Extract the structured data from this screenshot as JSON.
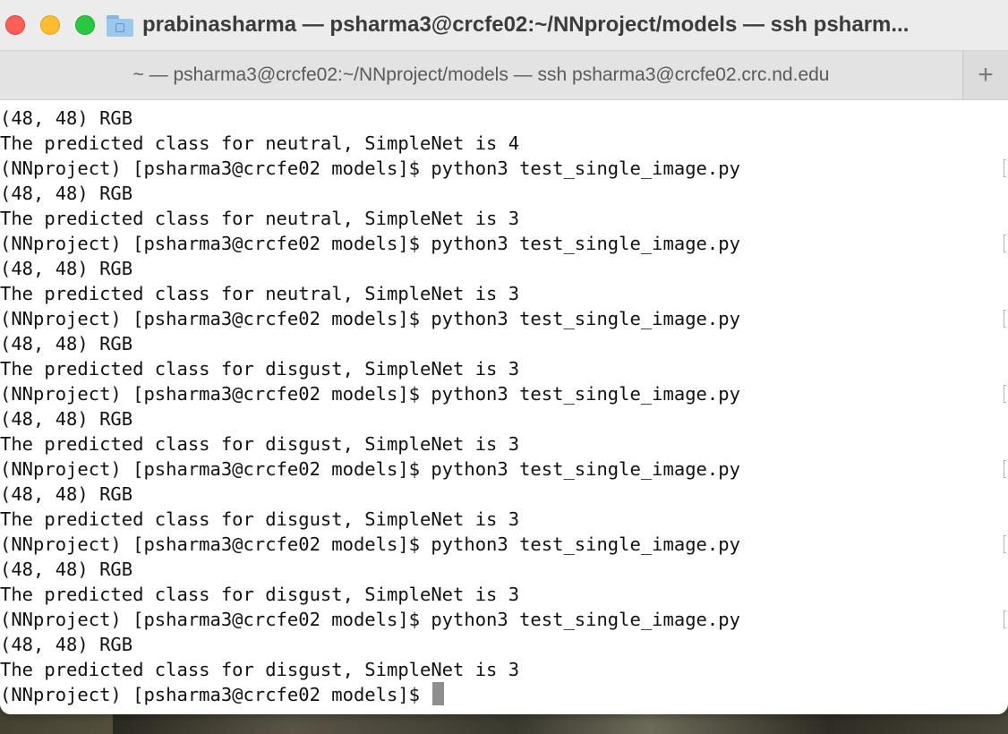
{
  "window": {
    "title": "prabinasharma — psharma3@crcfe02:~/NNproject/models — ssh psharm..."
  },
  "tabs": [
    {
      "label": "~ — psharma3@crcfe02:~/NNproject/models — ssh psharma3@crcfe02.crc.nd.edu"
    }
  ],
  "new_tab_label": "+",
  "terminal": {
    "lines": [
      {
        "text": "(48, 48) RGB",
        "marker": false
      },
      {
        "text": "The predicted class for neutral, SimpleNet is 4",
        "marker": false
      },
      {
        "text": "(NNproject) [psharma3@crcfe02 models]$ python3 test_single_image.py",
        "marker": true
      },
      {
        "text": "(48, 48) RGB",
        "marker": false
      },
      {
        "text": "The predicted class for neutral, SimpleNet is 3",
        "marker": false
      },
      {
        "text": "(NNproject) [psharma3@crcfe02 models]$ python3 test_single_image.py",
        "marker": true
      },
      {
        "text": "(48, 48) RGB",
        "marker": false
      },
      {
        "text": "The predicted class for neutral, SimpleNet is 3",
        "marker": false
      },
      {
        "text": "(NNproject) [psharma3@crcfe02 models]$ python3 test_single_image.py",
        "marker": true
      },
      {
        "text": "(48, 48) RGB",
        "marker": false
      },
      {
        "text": "The predicted class for disgust, SimpleNet is 3",
        "marker": false
      },
      {
        "text": "(NNproject) [psharma3@crcfe02 models]$ python3 test_single_image.py",
        "marker": true
      },
      {
        "text": "(48, 48) RGB",
        "marker": false
      },
      {
        "text": "The predicted class for disgust, SimpleNet is 3",
        "marker": false
      },
      {
        "text": "(NNproject) [psharma3@crcfe02 models]$ python3 test_single_image.py",
        "marker": true
      },
      {
        "text": "(48, 48) RGB",
        "marker": false
      },
      {
        "text": "The predicted class for disgust, SimpleNet is 3",
        "marker": false
      },
      {
        "text": "(NNproject) [psharma3@crcfe02 models]$ python3 test_single_image.py",
        "marker": true
      },
      {
        "text": "(48, 48) RGB",
        "marker": false
      },
      {
        "text": "The predicted class for disgust, SimpleNet is 3",
        "marker": false
      },
      {
        "text": "(NNproject) [psharma3@crcfe02 models]$ python3 test_single_image.py",
        "marker": true
      },
      {
        "text": "(48, 48) RGB",
        "marker": false
      },
      {
        "text": "The predicted class for disgust, SimpleNet is 3",
        "marker": false
      }
    ],
    "prompt": "(NNproject) [psharma3@crcfe02 models]$ "
  },
  "colors": {
    "close": "#ff5f57",
    "minimize": "#febc2e",
    "maximize": "#28c840",
    "cursor": "#8e8e8e"
  },
  "icons": {
    "title": "home-folder-icon"
  }
}
